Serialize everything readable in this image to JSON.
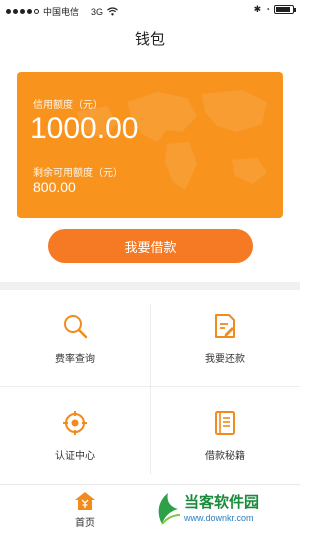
{
  "status_bar": {
    "carrier": "中国电信",
    "network": "3G"
  },
  "nav": {
    "title": "钱包"
  },
  "card": {
    "credit_label": "信用额度（元）",
    "credit_value": "1000.00",
    "available_label": "剩余可用额度（元）",
    "available_value": "800.00",
    "background_color": "#f8941e"
  },
  "actions": {
    "borrow_label": "我要借款",
    "accent_color": "#f57a23"
  },
  "grid": {
    "items": [
      {
        "label": "费率查询",
        "icon": "search-icon"
      },
      {
        "label": "我要还款",
        "icon": "document-edit-icon"
      },
      {
        "label": "认证中心",
        "icon": "target-icon"
      },
      {
        "label": "借款秘籍",
        "icon": "book-icon"
      }
    ]
  },
  "tabbar": {
    "home_label": "首页",
    "icon": "home-icon"
  },
  "watermark": {
    "title": "当客软件园",
    "url": "www.downkr.com"
  }
}
